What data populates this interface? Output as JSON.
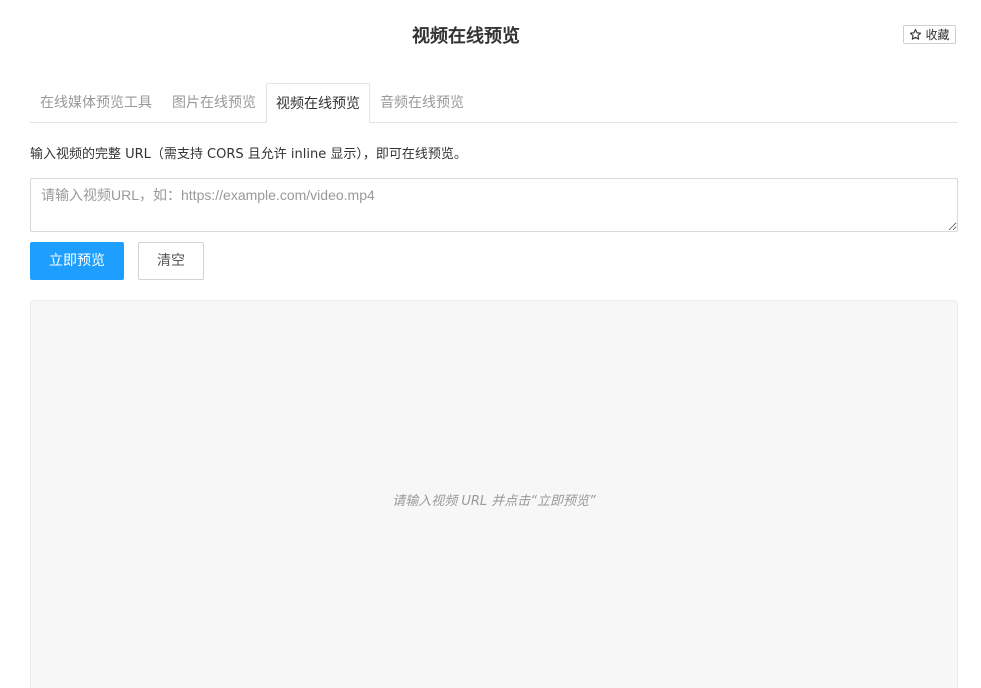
{
  "header": {
    "title": "视频在线预览",
    "favorite_label": "收藏",
    "favorite_icon": "star-outline-icon"
  },
  "tabs": [
    {
      "label": "在线媒体预览工具",
      "active": false
    },
    {
      "label": "图片在线预览",
      "active": false
    },
    {
      "label": "视频在线预览",
      "active": true
    },
    {
      "label": "音频在线预览",
      "active": false
    }
  ],
  "form": {
    "description": "输入视频的完整 URL（需支持 CORS 且允许 inline 显示），即可在线预览。",
    "url_value": "",
    "url_placeholder": "请输入视频URL，如：https://example.com/video.mp4",
    "preview_button_label": "立即预览",
    "clear_button_label": "清空"
  },
  "preview": {
    "hint": "请输入视频 URL 并点击“立即预览”"
  },
  "colors": {
    "primary": "#1e9fff",
    "preview_bg": "#f7f7f7",
    "tab_inactive": "#999999",
    "text": "#333333"
  }
}
